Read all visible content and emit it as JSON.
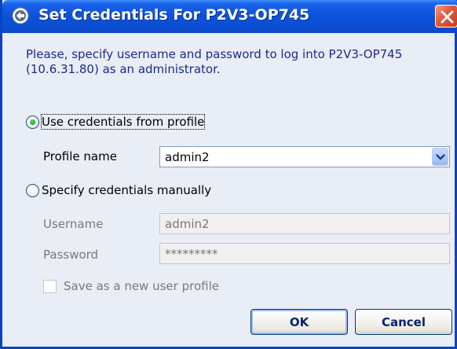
{
  "window": {
    "title": "Set Credentials For P2V3-OP745"
  },
  "icons": {
    "app": "converter-logo-icon",
    "close": "close-icon",
    "dropdown": "chevron-down-icon"
  },
  "intro": {
    "text": "Please, specify username and password to log into P2V3-OP745 (10.6.31.80) as an administrator."
  },
  "options": {
    "use_profile": {
      "label": "Use credentials from profile",
      "selected": true
    },
    "manual": {
      "label": "Specify credentials manually",
      "selected": false
    }
  },
  "profile": {
    "label": "Profile name",
    "value": "admin2"
  },
  "manual_fields": {
    "username_label": "Username",
    "username_value": "admin2",
    "password_label": "Password",
    "password_value": "*********"
  },
  "save_profile": {
    "label": "Save as a new user profile",
    "checked": false
  },
  "buttons": {
    "ok": "OK",
    "cancel": "Cancel"
  },
  "colors": {
    "title_bar": "#0b4ed2",
    "window_bg": "#e9edf5",
    "intro_text": "#1c2a8e",
    "close_button": "#e4573a"
  }
}
